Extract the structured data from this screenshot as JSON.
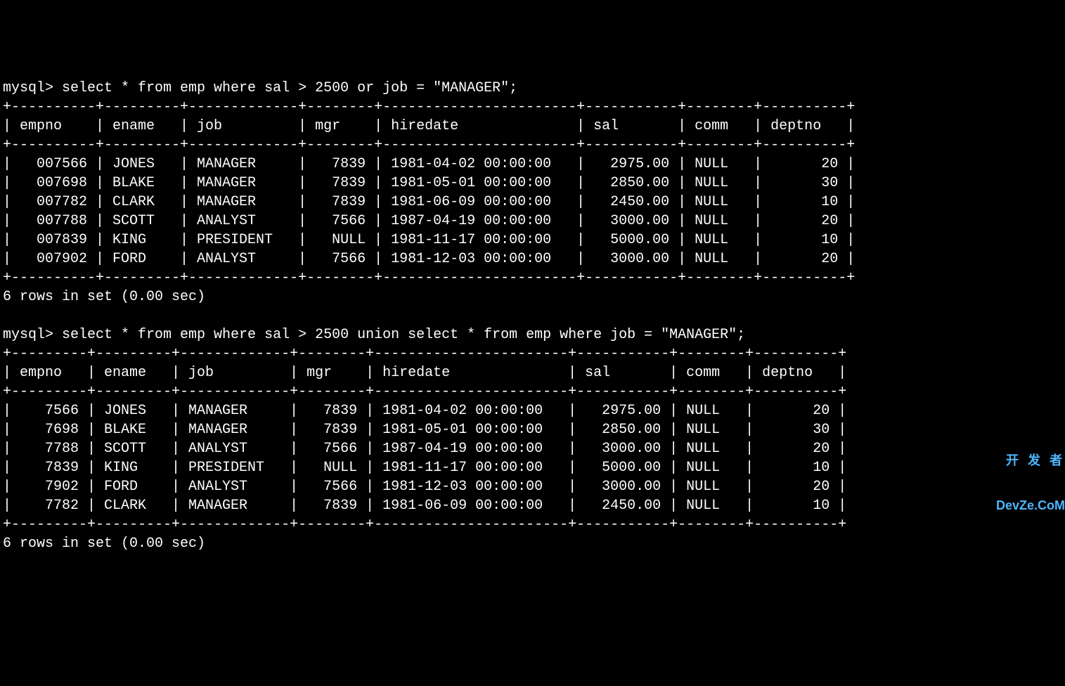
{
  "queries": [
    {
      "prompt": "mysql> ",
      "query": "select * from emp where sal > 2500 or job = \"MANAGER\";",
      "status": "6 rows in set (0.00 sec)",
      "cols": [
        {
          "name": "empno",
          "width": 8,
          "align": "right"
        },
        {
          "name": "ename",
          "width": 7,
          "align": "left"
        },
        {
          "name": "job",
          "width": 11,
          "align": "left"
        },
        {
          "name": "mgr",
          "width": 6,
          "align": "right"
        },
        {
          "name": "hiredate",
          "width": 21,
          "align": "left"
        },
        {
          "name": "sal",
          "width": 9,
          "align": "right"
        },
        {
          "name": "comm",
          "width": 6,
          "align": "left"
        },
        {
          "name": "deptno",
          "width": 8,
          "align": "right"
        }
      ],
      "rows": [
        [
          "007566",
          "JONES",
          "MANAGER",
          "7839",
          "1981-04-02 00:00:00",
          "2975.00",
          "NULL",
          "20"
        ],
        [
          "007698",
          "BLAKE",
          "MANAGER",
          "7839",
          "1981-05-01 00:00:00",
          "2850.00",
          "NULL",
          "30"
        ],
        [
          "007782",
          "CLARK",
          "MANAGER",
          "7839",
          "1981-06-09 00:00:00",
          "2450.00",
          "NULL",
          "10"
        ],
        [
          "007788",
          "SCOTT",
          "ANALYST",
          "7566",
          "1987-04-19 00:00:00",
          "3000.00",
          "NULL",
          "20"
        ],
        [
          "007839",
          "KING",
          "PRESIDENT",
          "NULL",
          "1981-11-17 00:00:00",
          "5000.00",
          "NULL",
          "10"
        ],
        [
          "007902",
          "FORD",
          "ANALYST",
          "7566",
          "1981-12-03 00:00:00",
          "3000.00",
          "NULL",
          "20"
        ]
      ]
    },
    {
      "prompt": "mysql> ",
      "query": "select * from emp where sal > 2500 union select * from emp where job = \"MANAGER\";",
      "status": "6 rows in set (0.00 sec)",
      "cols": [
        {
          "name": "empno",
          "width": 7,
          "align": "right"
        },
        {
          "name": "ename",
          "width": 7,
          "align": "left"
        },
        {
          "name": "job",
          "width": 11,
          "align": "left"
        },
        {
          "name": "mgr",
          "width": 6,
          "align": "right"
        },
        {
          "name": "hiredate",
          "width": 21,
          "align": "left"
        },
        {
          "name": "sal",
          "width": 9,
          "align": "right"
        },
        {
          "name": "comm",
          "width": 6,
          "align": "left"
        },
        {
          "name": "deptno",
          "width": 8,
          "align": "right"
        }
      ],
      "rows": [
        [
          "7566",
          "JONES",
          "MANAGER",
          "7839",
          "1981-04-02 00:00:00",
          "2975.00",
          "NULL",
          "20"
        ],
        [
          "7698",
          "BLAKE",
          "MANAGER",
          "7839",
          "1981-05-01 00:00:00",
          "2850.00",
          "NULL",
          "30"
        ],
        [
          "7788",
          "SCOTT",
          "ANALYST",
          "7566",
          "1987-04-19 00:00:00",
          "3000.00",
          "NULL",
          "20"
        ],
        [
          "7839",
          "KING",
          "PRESIDENT",
          "NULL",
          "1981-11-17 00:00:00",
          "5000.00",
          "NULL",
          "10"
        ],
        [
          "7902",
          "FORD",
          "ANALYST",
          "7566",
          "1981-12-03 00:00:00",
          "3000.00",
          "NULL",
          "20"
        ],
        [
          "7782",
          "CLARK",
          "MANAGER",
          "7839",
          "1981-06-09 00:00:00",
          "2450.00",
          "NULL",
          "10"
        ]
      ]
    }
  ],
  "watermark": {
    "top_text": "开 发 者",
    "bottom_text": "DevZe.CoM"
  }
}
